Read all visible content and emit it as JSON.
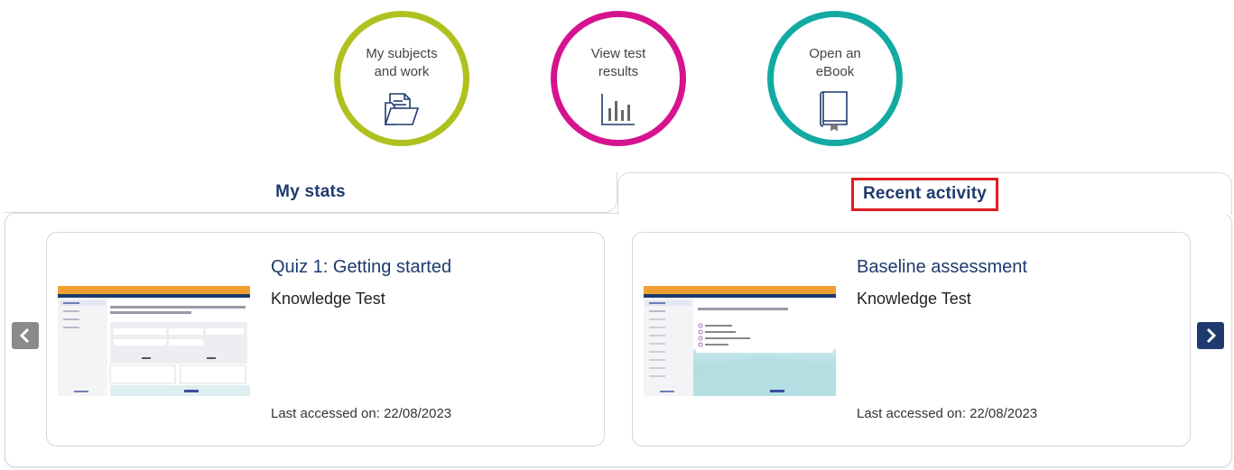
{
  "quick_links": [
    {
      "line1": "My subjects",
      "line2": "and work",
      "icon": "folder-documents-icon",
      "color": "#afc11e"
    },
    {
      "line1": "View test",
      "line2": "results",
      "icon": "bar-chart-icon",
      "color": "#d6138f"
    },
    {
      "line1": "Open an",
      "line2": "eBook",
      "icon": "ebook-icon",
      "color": "#12aaa3"
    }
  ],
  "tabs": {
    "stats": "My stats",
    "recent": "Recent activity",
    "active": "recent"
  },
  "cards": [
    {
      "title": "Quiz 1: Getting started",
      "type": "Knowledge Test",
      "accessed": "Last accessed on: 22/08/2023"
    },
    {
      "title": "Baseline assessment",
      "type": "Knowledge Test",
      "accessed": "Last accessed on: 22/08/2023"
    }
  ],
  "colors": {
    "brand_navy": "#1e3a6e",
    "highlight_red": "#e11b22",
    "thumb_header_orange": "#f0a030"
  }
}
